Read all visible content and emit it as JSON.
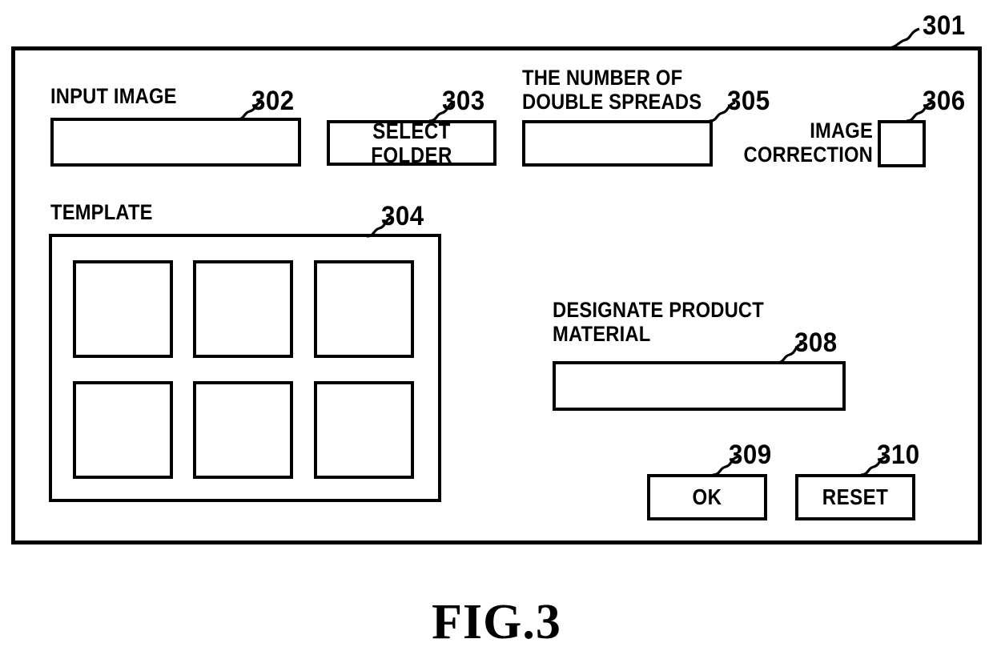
{
  "figure": {
    "caption": "FIG.3",
    "dialog_ref": "301"
  },
  "dialog": {
    "input_image": {
      "label": "INPUT IMAGE",
      "ref": "302",
      "value": ""
    },
    "select_folder": {
      "label": "SELECT FOLDER",
      "ref": "303"
    },
    "double_spreads": {
      "label": "THE NUMBER OF\nDOUBLE SPREADS",
      "ref": "305",
      "value": ""
    },
    "image_correction": {
      "label": "IMAGE\nCORRECTION",
      "ref": "306",
      "checked": false
    },
    "template": {
      "label": "TEMPLATE",
      "ref": "304",
      "thumbnails": [
        {
          "name": "template-thumbnail-1"
        },
        {
          "name": "template-thumbnail-2"
        },
        {
          "name": "template-thumbnail-3"
        },
        {
          "name": "template-thumbnail-4"
        },
        {
          "name": "template-thumbnail-5"
        },
        {
          "name": "template-thumbnail-6"
        }
      ]
    },
    "product_material": {
      "label": "DESIGNATE PRODUCT\nMATERIAL",
      "ref": "308",
      "value": ""
    },
    "ok_button": {
      "label": "OK",
      "ref": "309"
    },
    "reset_button": {
      "label": "RESET",
      "ref": "310"
    }
  }
}
